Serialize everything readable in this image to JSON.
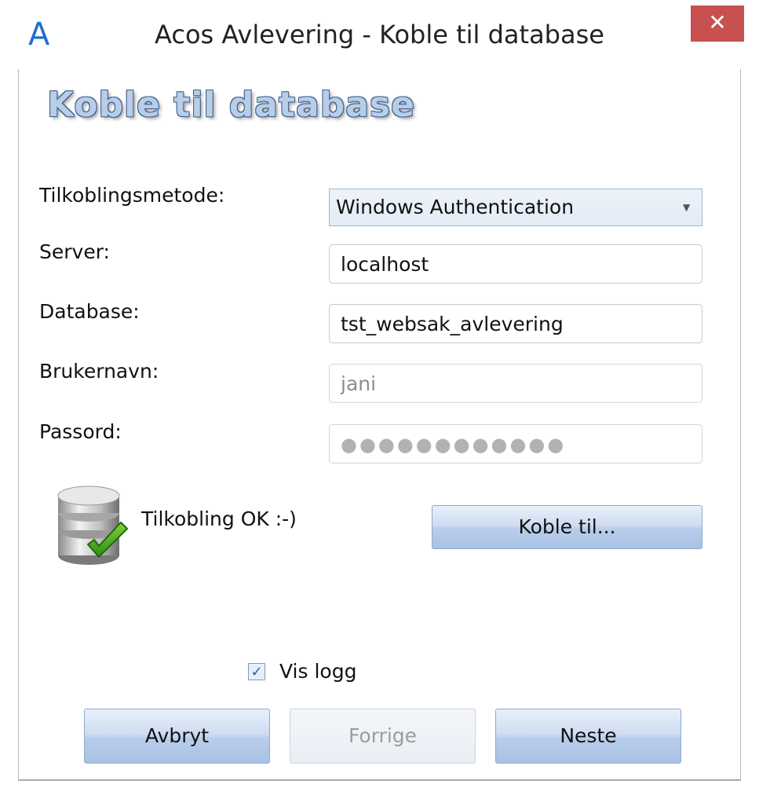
{
  "window": {
    "title": "Acos Avlevering - Koble til database",
    "app_icon": "A",
    "close_symbol": "✕"
  },
  "heading": "Koble til database",
  "form": {
    "method_label": "Tilkoblingsmetode:",
    "method_value": "Windows Authentication",
    "server_label": "Server:",
    "server_value": "localhost",
    "database_label": "Database:",
    "database_value": "tst_websak_avlevering",
    "username_label": "Brukernavn:",
    "username_value": "jani",
    "password_label": "Passord:",
    "password_masked": "●●●●●●●●●●●●"
  },
  "status": {
    "text": "Tilkobling OK :-)",
    "icon": "database-ok-icon"
  },
  "connect_button": "Koble til...",
  "show_log": {
    "label": "Vis logg",
    "checked": true
  },
  "nav": {
    "cancel": "Avbryt",
    "previous": "Forrige",
    "next": "Neste"
  },
  "colors": {
    "accent": "#1e6fd0",
    "close": "#c75050",
    "button": "#b8cdea"
  }
}
